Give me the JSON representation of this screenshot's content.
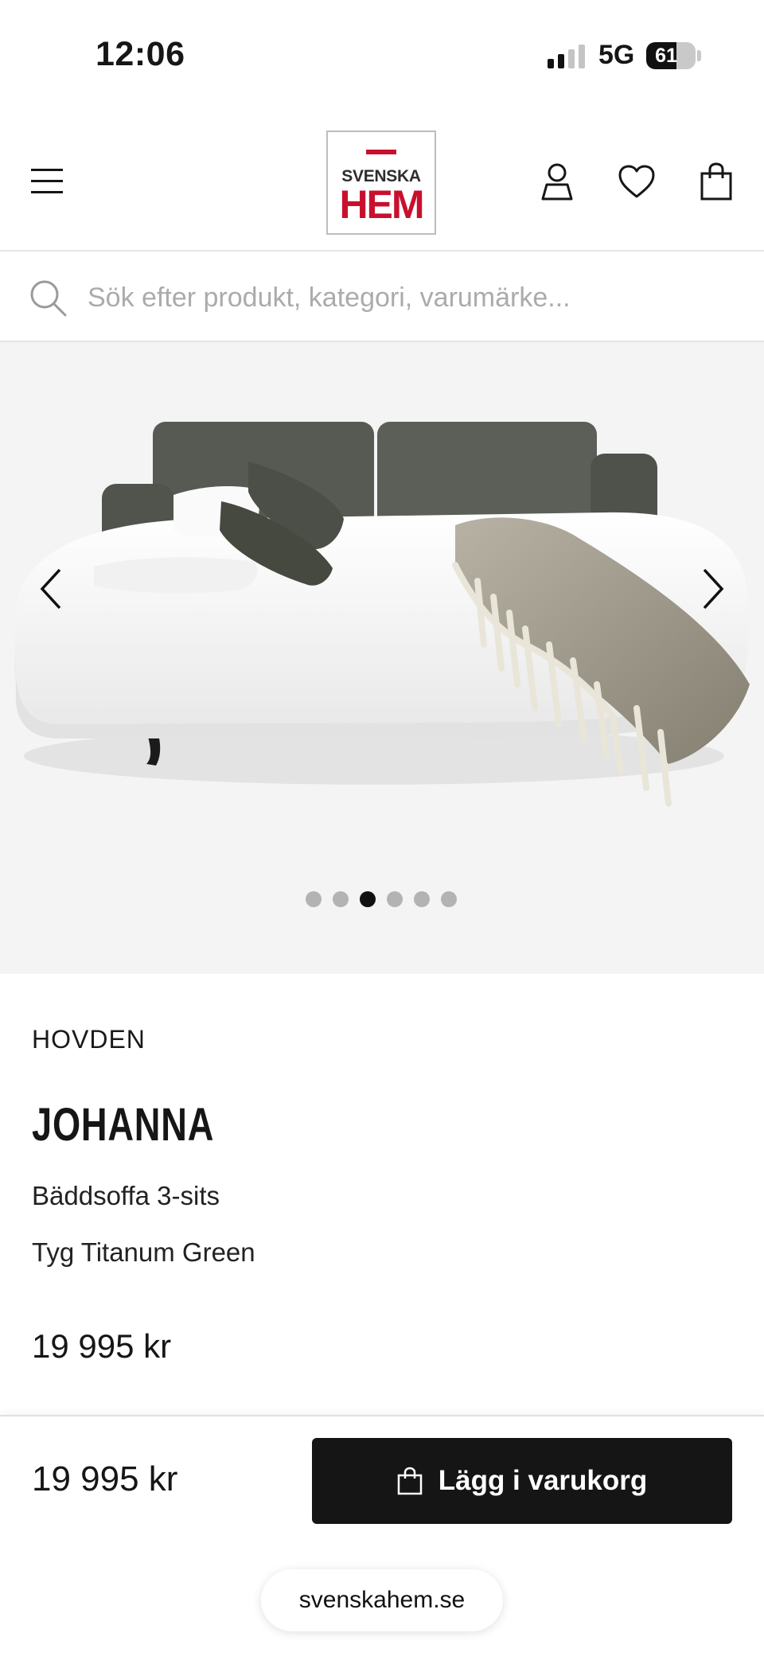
{
  "status_bar": {
    "time": "12:06",
    "network": "5G",
    "battery": "61",
    "battery_level_percent": 61
  },
  "header": {
    "logo_line1": "SVENSKA",
    "logo_line2": "HEM",
    "icons": [
      "menu-icon",
      "user-icon",
      "heart-icon",
      "shopping-bag-icon"
    ]
  },
  "search": {
    "placeholder": "Sök efter produkt, kategori, varumärke...",
    "value": ""
  },
  "gallery": {
    "image_count": 6,
    "active_index": 2,
    "image_description_icon": "sofa-bed-image"
  },
  "product": {
    "brand": "HOVDEN",
    "name": "JOHANNA",
    "type": "Bäddsoffa 3-sits",
    "fabric": "Tyg Titanum Green",
    "price": "19 995 kr"
  },
  "sticky": {
    "price": "19 995 kr",
    "add_to_cart_label": "Lägg i varukorg"
  },
  "browser": {
    "url": "svenskahem.se"
  },
  "colors": {
    "accent": "#151515",
    "brand_red": "#c8102e",
    "gallery_bg": "#f4f4f4"
  }
}
